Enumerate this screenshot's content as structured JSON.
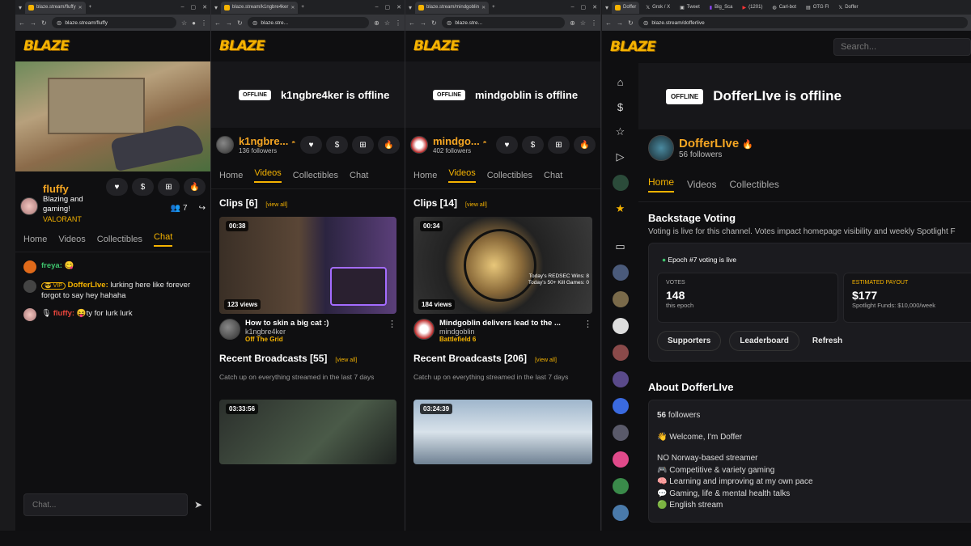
{
  "colors": {
    "accent": "#f5b301",
    "name": "#f5a623",
    "chat_green": "#3ec46d",
    "chat_red": "#e8453c"
  },
  "logo": "BLAZE",
  "win1": {
    "tab": "blaze.stream/fluffy",
    "url": "blaze.stream/fluffy",
    "channel": {
      "name": "fluffy",
      "title": "Blazing and gaming!",
      "game": "VALORANT",
      "viewers": "7"
    },
    "tabs": [
      "Home",
      "Videos",
      "Collectibles",
      "Chat"
    ],
    "chat": [
      {
        "user": "freya:",
        "msg": "😋",
        "color": "#3ec46d"
      },
      {
        "badge": "😎 VIP",
        "user": "DofferLIve:",
        "msg": "lurking here like forever forgot to say hey hahaha",
        "color": "#f5b301"
      },
      {
        "user": "fluffy:",
        "msg": "😝ty for lurk lurk",
        "color": "#e8453c",
        "prefix": "🎙"
      }
    ],
    "chat_placeholder": "Chat..."
  },
  "win2": {
    "tab": "blaze.stream/k1ngbre4ker",
    "url": "blaze.stre...",
    "offline_badge": "OFFLINE",
    "offline_text": "k1ngbre4ker is offline",
    "channel": {
      "name": "k1ngbre...",
      "followers": "136 followers"
    },
    "tabs": [
      "Home",
      "Videos",
      "Collectibles",
      "Chat"
    ],
    "clips_title": "Clips [6]",
    "view_all": "[view all]",
    "clip": {
      "duration": "00:38",
      "views": "123 views",
      "title": "How to skin a big cat :)",
      "author": "k1ngbre4ker",
      "game": "Off The Grid"
    },
    "broadcasts_title": "Recent Broadcasts [55]",
    "broadcasts_view_all": "[view all]",
    "broadcasts_desc": "Catch up on everything streamed in the last 7 days",
    "broadcast_duration": "03:33:56"
  },
  "win3": {
    "tab": "blaze.stream/mindgoblin",
    "url": "blaze.stre...",
    "offline_badge": "OFFLINE",
    "offline_text": "mindgoblin is offline",
    "channel": {
      "name": "mindgo...",
      "followers": "402 followers"
    },
    "tabs": [
      "Home",
      "Videos",
      "Collectibles",
      "Chat"
    ],
    "clips_title": "Clips [14]",
    "view_all": "[view all]",
    "clip": {
      "duration": "00:34",
      "views": "184 views",
      "title": "Mindgoblin delivers lead to the ...",
      "author": "mindgoblin",
      "game": "Battlefield 6",
      "overlay1": "Today's REDSEC Wins: 8",
      "overlay2": "Today's 50+ Kill Games: 0"
    },
    "broadcasts_title": "Recent Broadcasts [206]",
    "broadcasts_view_all": "[view all]",
    "broadcasts_desc": "Catch up on everything streamed in the last 7 days",
    "broadcast_duration": "03:24:39"
  },
  "win4": {
    "tabs": [
      "Doffer",
      "Grok / X",
      "Tweet",
      "Big_Sca",
      "(1201)",
      "Carl-bot",
      "OTG Fl",
      "Doffer"
    ],
    "url": "blaze.stream/dofferlive",
    "search_placeholder": "Search...",
    "offline_badge": "OFFLINE",
    "offline_text": "DofferLIve is offline",
    "channel": {
      "name": "DofferLIve",
      "followers": "56 followers"
    },
    "tabs_main": [
      "Home",
      "Videos",
      "Collectibles"
    ],
    "voting": {
      "title": "Backstage Voting",
      "desc": "Voting is live for this channel. Votes impact homepage visibility and weekly Spotlight F",
      "epoch": "Epoch #7 voting is live",
      "votes_label": "VOTES",
      "votes": "148",
      "votes_sub": "this epoch",
      "payout_label": "ESTIMATED PAYOUT",
      "payout": "$177",
      "payout_sub": "Spotlight Funds: $10,000/week",
      "btn_supporters": "Supporters",
      "btn_leaderboard": "Leaderboard",
      "btn_refresh": "Refresh"
    },
    "about": {
      "title": "About DofferLIve",
      "followers_count": "56",
      "followers_word": "followers",
      "welcome": "👋 Welcome, I'm Doffer",
      "lines": [
        "NO Norway-based streamer",
        "🎮 Competitive & variety gaming",
        "🧠 Learning and improving at my own pace",
        "💬 Gaming, life & mental health talks",
        "🟢 English stream"
      ]
    }
  }
}
